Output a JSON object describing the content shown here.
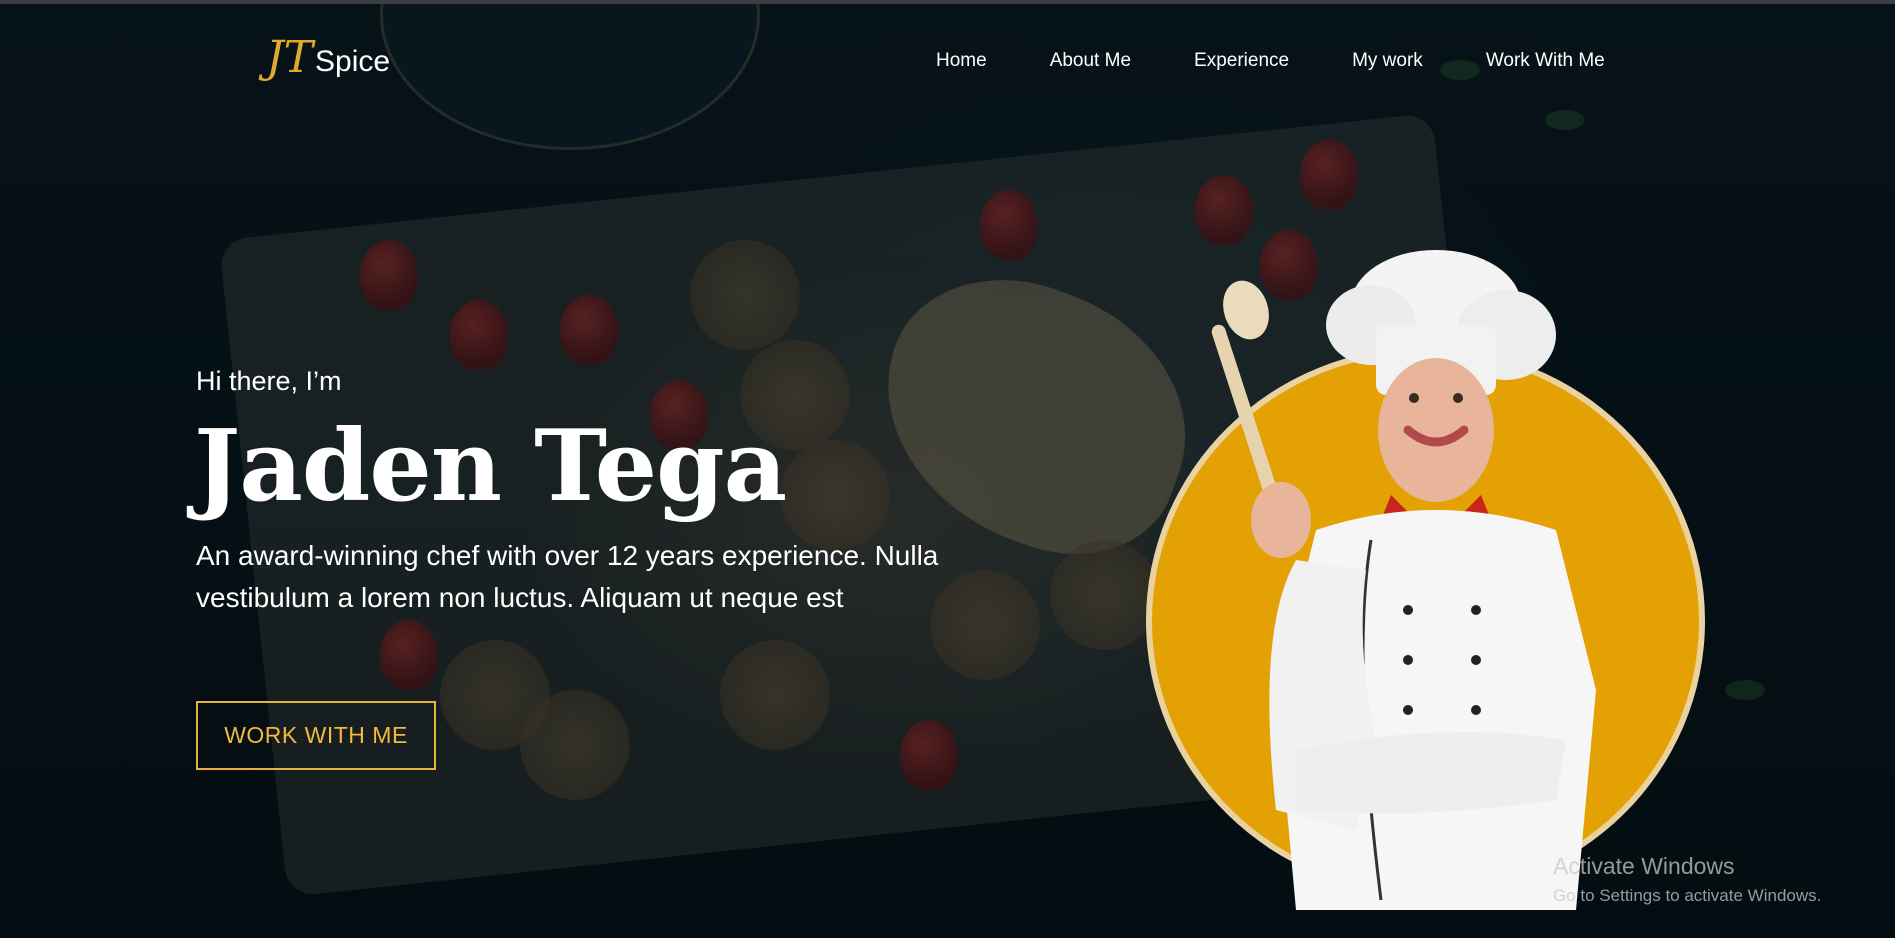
{
  "header": {
    "logo": {
      "mark": "JT",
      "text": "Spice"
    },
    "nav": [
      "Home",
      "About Me",
      "Experience",
      "My work",
      "Work With Me"
    ]
  },
  "hero": {
    "greeting": "Hi there, I’m",
    "name": "Jaden Tega",
    "description": "An award-winning chef with over 12 years experience. Nulla vestibulum a lorem non luctus. Aliquam ut neque est",
    "cta": "WORK WITH ME"
  },
  "watermark": {
    "title": "Activate Windows",
    "subtitle": "Go to Settings to activate Windows."
  },
  "colors": {
    "accent": "#e8b33a",
    "portrait_circle": "#e3a103",
    "background": "#0a1418"
  }
}
